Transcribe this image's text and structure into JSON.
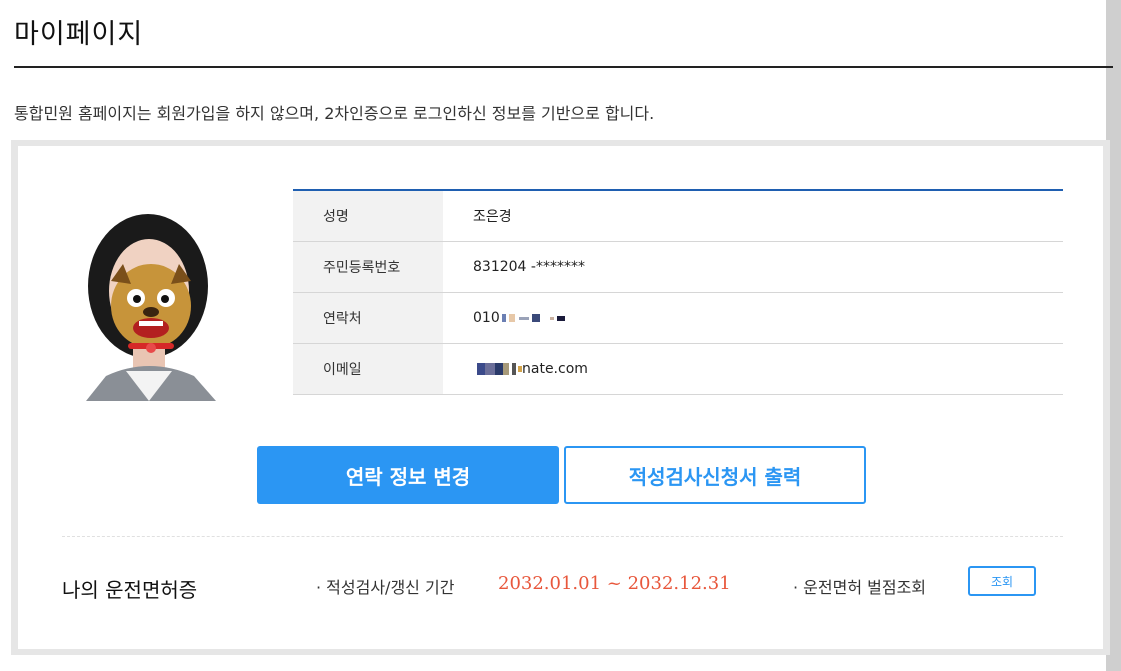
{
  "page": {
    "title": "마이페이지",
    "notice": "통합민원 홈페이지는 회원가입을 하지 않으며, 2차인증으로 로그인하신 정보를 기반으로 합니다."
  },
  "profile": {
    "rows": [
      {
        "label": "성명",
        "value": "조은경"
      },
      {
        "label": "주민등록번호",
        "value": "831204 -*******"
      },
      {
        "label": "연락처",
        "value": "010"
      },
      {
        "label": "이메일",
        "value": "nate.com"
      }
    ]
  },
  "buttons": {
    "change_contact": "연락 정보 변경",
    "print_form": "적성검사신청서 출력"
  },
  "license": {
    "title": "나의 운전면허증",
    "renewal_label": "· 적성검사/갱신 기간",
    "renewal_period": "2032.01.01 ~ 2032.12.31",
    "penalty_label": "· 운전면허 벌점조회",
    "lookup_button": "조회"
  },
  "colors": {
    "accent": "#2b96f3",
    "table_border": "#1f5fb1",
    "period": "#e8573c"
  }
}
